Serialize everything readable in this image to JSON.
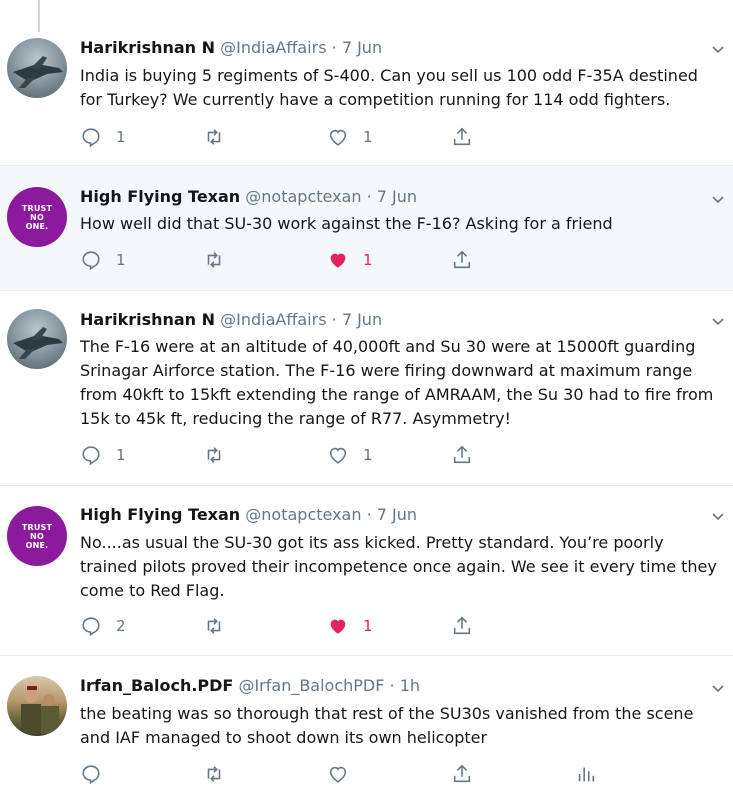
{
  "tweets": [
    {
      "name": "Harikrishnan N",
      "handle": "@IndiaAffairs",
      "separator": "·",
      "time": "7 Jun",
      "text": "India is buying 5 regiments of S-400. Can you sell us 100 odd F-35A destined for Turkey? We currently have a competition running for 114 odd fighters.",
      "replies": "1",
      "retweets": "",
      "likes": "1",
      "liked": false,
      "avatar": "jet-avatar"
    },
    {
      "name": "High Flying Texan",
      "handle": "@notapctexan",
      "separator": "·",
      "time": "7 Jun",
      "text": "How well did that SU-30 work against the F-16? Asking for a friend",
      "replies": "1",
      "retweets": "",
      "likes": "1",
      "liked": true,
      "avatar": "trust-no-one-avatar",
      "avatar_lines": [
        "TRUST",
        "NO",
        "ONE."
      ]
    },
    {
      "name": "Harikrishnan N",
      "handle": "@IndiaAffairs",
      "separator": "·",
      "time": "7 Jun",
      "text": "The F-16 were at an altitude of 40,000ft and Su 30 were at 15000ft guarding Srinagar Airforce station. The F-16 were firing downward at maximum range from 40kft to 15kft extending the range of AMRAAM, the Su 30 had to fire from 15k to 45k ft, reducing the range of R77. Asymmetry!",
      "replies": "1",
      "retweets": "",
      "likes": "1",
      "liked": false,
      "avatar": "jet-avatar"
    },
    {
      "name": "High Flying Texan",
      "handle": "@notapctexan",
      "separator": "·",
      "time": "7 Jun",
      "text": "No....as usual the SU-30 got its ass kicked. Pretty standard. You’re poorly trained pilots proved their incompetence once again. We see it every time they come to Red Flag.",
      "replies": "2",
      "retweets": "",
      "likes": "1",
      "liked": true,
      "avatar": "trust-no-one-avatar",
      "avatar_lines": [
        "TRUST",
        "NO",
        "ONE."
      ]
    },
    {
      "name": "Irfan_Baloch.PDF",
      "handle": "@Irfan_BalochPDF",
      "separator": "·",
      "time": "1h",
      "text": "the beating was so thorough  that rest of the SU30s vanished from the scene and IAF managed to shoot down its own helicopter",
      "replies": "",
      "retweets": "",
      "likes": "",
      "liked": false,
      "avatar": "person-avatar"
    }
  ],
  "colors": {
    "text": "#14171a",
    "muted": "#657786",
    "like_active": "#e0245e",
    "highlight_bg": "#f5f8fa",
    "border": "#e6ecf0",
    "trust_avatar_bg": "#8b1a9c"
  }
}
